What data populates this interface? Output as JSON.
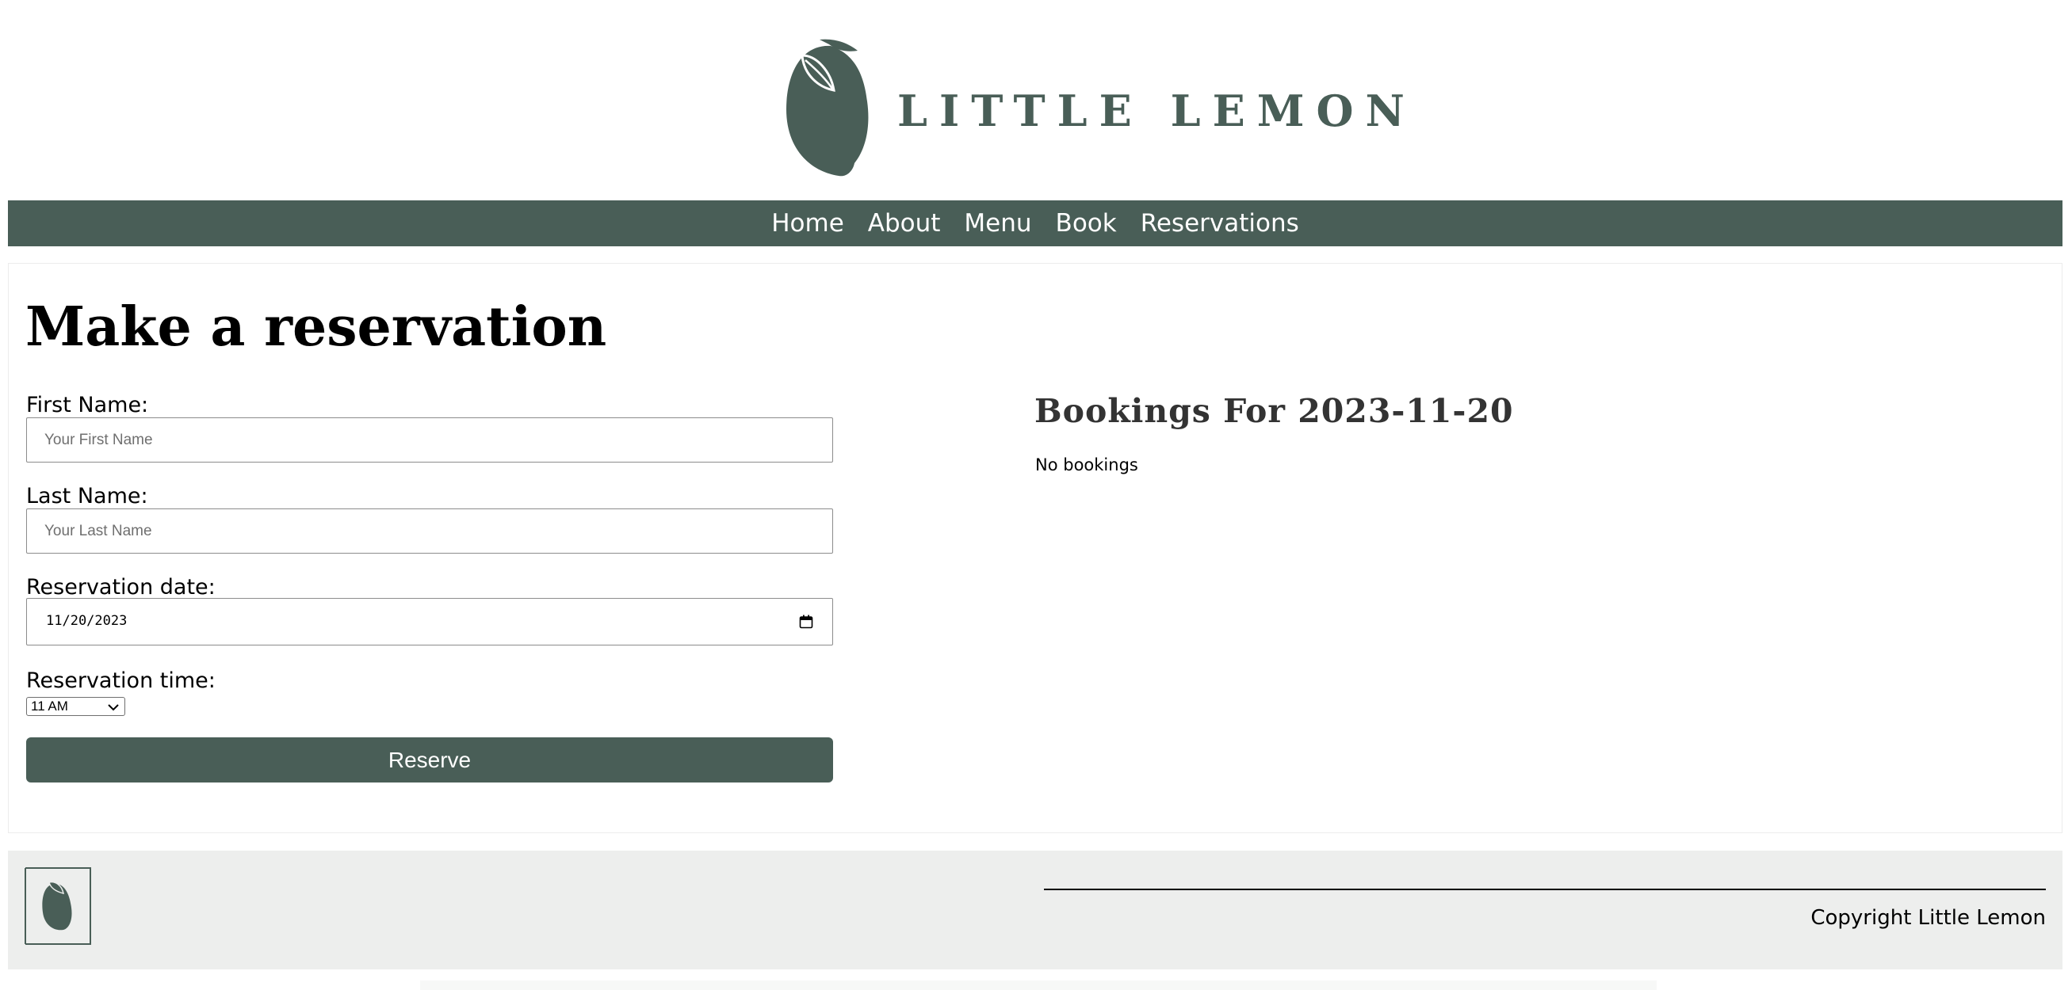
{
  "brand": {
    "name": "LITTLE LEMON",
    "color": "#495e57"
  },
  "nav": {
    "items": [
      "Home",
      "About",
      "Menu",
      "Book",
      "Reservations"
    ]
  },
  "form": {
    "title": "Make a reservation",
    "first_name": {
      "label": "First Name:",
      "placeholder": "Your First Name",
      "value": ""
    },
    "last_name": {
      "label": "Last Name:",
      "placeholder": "Your Last Name",
      "value": ""
    },
    "date": {
      "label": "Reservation date:",
      "value": "11/20/2023",
      "icon": "calendar-icon"
    },
    "time": {
      "label": "Reservation time:",
      "selected": "11 AM"
    },
    "submit_label": "Reserve"
  },
  "bookings": {
    "title": "Bookings For 2023-11-20",
    "empty_text": "No bookings"
  },
  "footer": {
    "copyright": "Copyright Little Lemon",
    "background": "#edeeed"
  }
}
